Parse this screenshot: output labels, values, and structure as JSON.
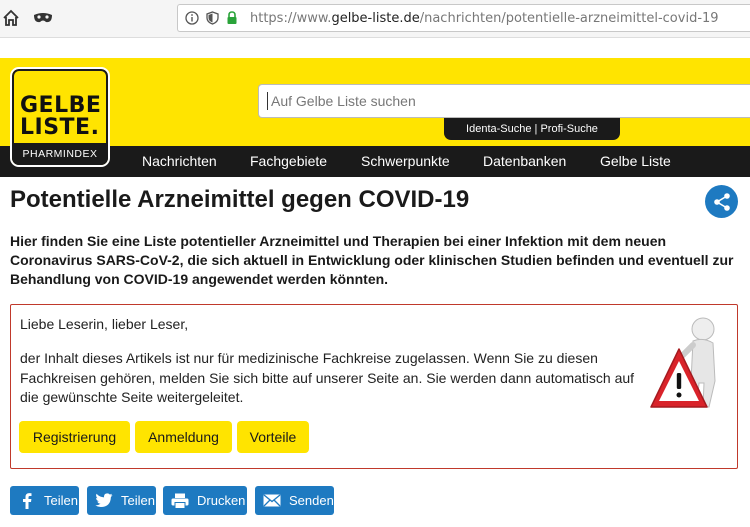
{
  "browser": {
    "url_prefix": "https://www.",
    "url_domain": "gelbe-liste.de",
    "url_path": "/nachrichten/potentielle-arzneimittel-covid-19"
  },
  "header": {
    "logo_line1": "GELBE",
    "logo_line2": "LISTE.",
    "logo_sub": "PHARMINDEX",
    "search_placeholder": "Auf Gelbe Liste suchen",
    "identa_label": "Identa-Suche | Profi-Suche",
    "brand_color": "#ffe400"
  },
  "nav": {
    "items": [
      "Nachrichten",
      "Fachgebiete",
      "Schwerpunkte",
      "Datenbanken",
      "Gelbe Liste"
    ]
  },
  "article": {
    "title": "Potentielle Arzneimittel gegen COVID-19",
    "intro": "Hier finden Sie eine Liste potentieller Arzneimittel und Therapien bei einer Infektion mit dem neuen Coronavirus SARS-CoV-2, die sich aktuell in Entwicklung oder klinischen Studien befinden und eventuell zur Behandlung von COVID-19 angewendet werden könnten."
  },
  "notice": {
    "greeting": "Liebe Leserin, lieber Leser,",
    "body": "der Inhalt dieses Artikels ist nur für medizinische Fachkreise zugelassen. Wenn Sie zu diesen Fachkreisen gehören, melden Sie sich bitte auf unserer Seite an. Sie werden dann automatisch auf die gewünschte Seite weitergeleitet.",
    "buttons": [
      "Registrierung",
      "Anmeldung",
      "Vorteile"
    ]
  },
  "share_buttons": [
    "Teilen",
    "Teilen",
    "Drucken",
    "Senden"
  ],
  "colors": {
    "accent_blue": "#1e7ac1",
    "notice_border": "#c0392b"
  }
}
